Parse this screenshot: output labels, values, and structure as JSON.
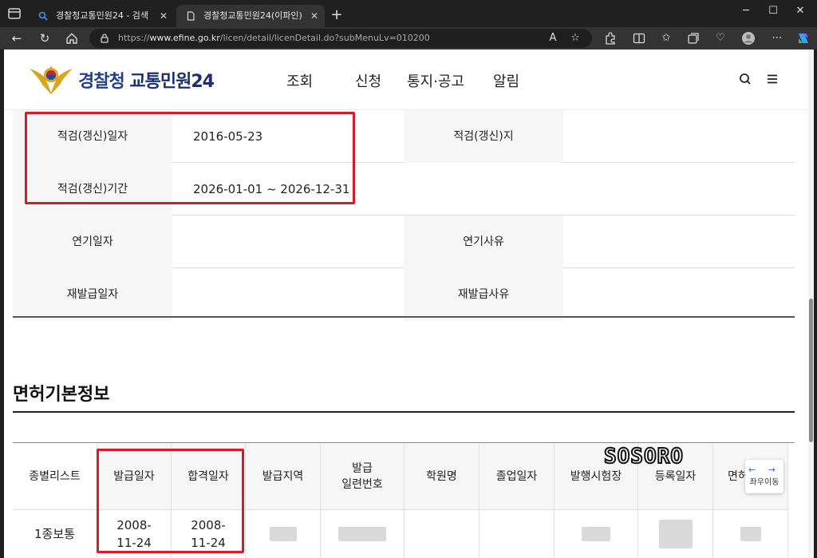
{
  "browser": {
    "tabs": [
      {
        "title": "경찰청교통민원24 - 검색",
        "active": false
      },
      {
        "title": "경찰청교통민원24(이파인)",
        "active": true
      }
    ],
    "url_prefix": "https://",
    "url_host": "www.efine.go.kr",
    "url_path": "/licen/detail/licenDetail.do?subMenuLv=010200",
    "reader_label": "A"
  },
  "site": {
    "logo_main": "경찰청",
    "logo_sub": "교통민원24",
    "nav": [
      "조회",
      "신청",
      "통지·공고",
      "알림"
    ]
  },
  "detail_rows": [
    {
      "label1": "적검(갱신)일자",
      "value1": "2016-05-23",
      "label2": "적검(갱신)지",
      "value2": ""
    },
    {
      "label1": "적검(갱신)기간",
      "value1": "2026-01-01 ~ 2026-12-31",
      "label2": "",
      "value2": ""
    },
    {
      "label1": "연기일자",
      "value1": "",
      "label2": "연기사유",
      "value2": ""
    },
    {
      "label1": "재발급일자",
      "value1": "",
      "label2": "재발급사유",
      "value2": ""
    }
  ],
  "license_section": {
    "title": "면허기본정보",
    "headers": [
      "종별리스트",
      "발급일자",
      "합격일자",
      "발급지역",
      "발급\n일련번호",
      "학원명",
      "졸업일자",
      "발행시험장",
      "등록일자",
      "면허"
    ],
    "row": {
      "type": "1종보통",
      "issue_date": "2008-\n11-24",
      "pass_date": "2008-\n11-24"
    }
  },
  "watermark": "SOSORO",
  "scroll_hint": {
    "label": "좌우이동",
    "arrows": "← →"
  },
  "colors": {
    "highlight": "#d41c2a",
    "brand_blue": "#233f8c",
    "label_bg": "#f6f6f6"
  }
}
